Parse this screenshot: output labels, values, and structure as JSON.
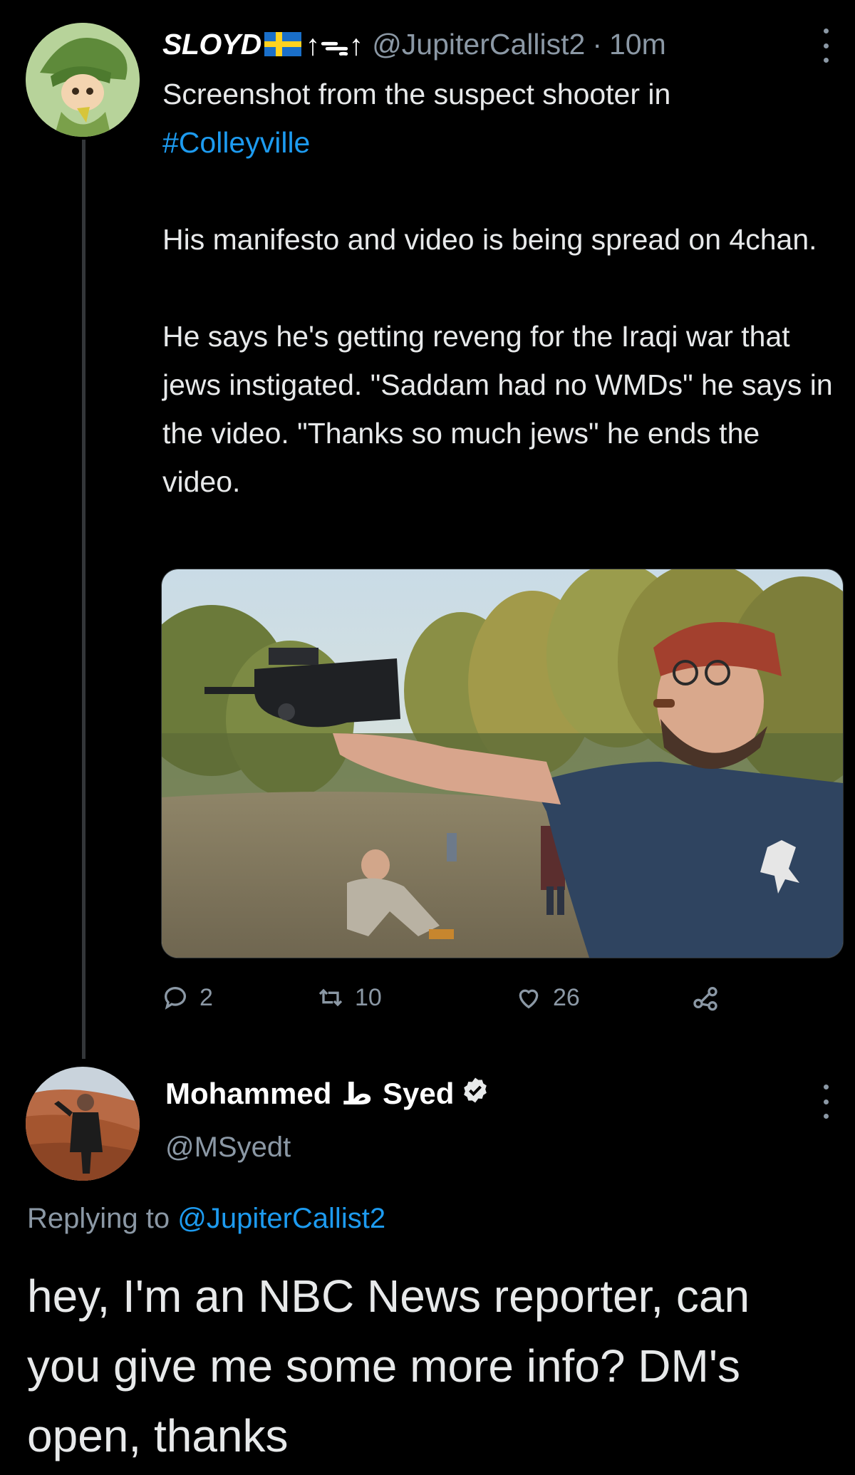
{
  "tweet": {
    "display_name": "SLOYD",
    "name_glyphs": "↑ᯓ↑",
    "handle": "@JupiterCallist2",
    "separator": "·",
    "time": "10m",
    "text_line1": "Screenshot from the suspect shooter in",
    "hashtag": "#Colleyville",
    "text_para2": "His manifesto and video is being spread on 4chan.",
    "text_para3": "He says he's getting reveng for the Iraqi war that jews instigated. \"Saddam had no WMDs\" he says in the video. \"Thanks so much jews\" he ends the video.",
    "media_icon": "photo-of-man-with-gun",
    "actions": {
      "reply_count": "2",
      "retweet_count": "10",
      "like_count": "26"
    }
  },
  "reply": {
    "display_name_first": "Mohammed",
    "display_name_arabic": "ط",
    "display_name_last": "Syed",
    "handle": "@MSyedt",
    "replying_label": "Replying to",
    "replying_handle": "@JupiterCallist2",
    "text": "hey, I'm an NBC News reporter, can you give me some more info? DM's open, thanks"
  },
  "colors": {
    "background": "#000000",
    "text": "#e7e9ea",
    "secondary": "#8b98a5",
    "accent": "#1d9bf0"
  }
}
